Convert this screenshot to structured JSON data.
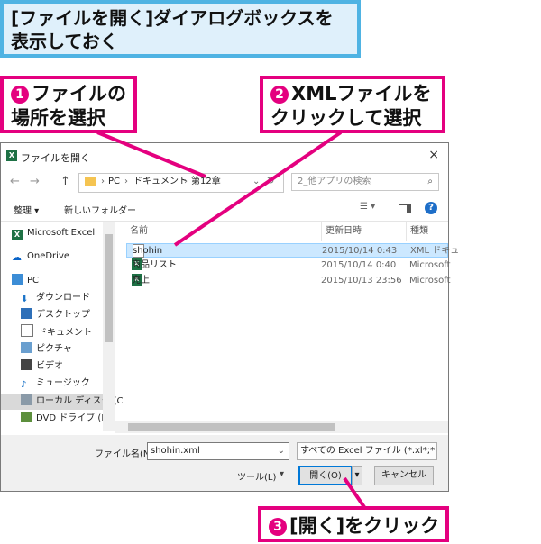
{
  "banner": {
    "line1": "[ファイルを開く]ダイアログボックスを",
    "line2": "表示しておく"
  },
  "callouts": [
    {
      "num": "1",
      "line1": "ファイルの",
      "line2": "場所を選択"
    },
    {
      "num": "2",
      "line1": "XMLファイルを",
      "line2": "クリックして選択"
    },
    {
      "num": "3",
      "line1": "[開く]をクリック"
    }
  ],
  "dialog": {
    "title": "ファイルを開く",
    "close": "×",
    "nav": {
      "back": "←",
      "forward": "→",
      "up": "↑",
      "path": [
        "PC",
        "ドキュメント",
        "第12章"
      ],
      "search_placeholder": "2_他アプリの検索"
    },
    "toolbar": {
      "organize": "整理 ▾",
      "new_folder": "新しいフォルダー"
    },
    "sidebar": [
      {
        "label": "Microsoft Excel",
        "icon": "excel-icon"
      },
      {
        "label": "OneDrive",
        "icon": "cloud-icon"
      },
      {
        "label": "PC",
        "icon": "computer-icon"
      },
      {
        "label": "ダウンロード",
        "icon": "download-icon"
      },
      {
        "label": "デスクトップ",
        "icon": "desktop-icon"
      },
      {
        "label": "ドキュメント",
        "icon": "document-icon"
      },
      {
        "label": "ピクチャ",
        "icon": "picture-icon"
      },
      {
        "label": "ビデオ",
        "icon": "video-icon"
      },
      {
        "label": "ミュージック",
        "icon": "music-icon"
      },
      {
        "label": "ローカル ディスク (C",
        "icon": "disk-icon"
      },
      {
        "label": "DVD ドライブ (D:)",
        "icon": "dvd-icon"
      }
    ],
    "columns": [
      "名前",
      "更新日時",
      "種類"
    ],
    "files": [
      {
        "name": "shohin",
        "date": "2015/10/14 0:43",
        "type": "XML ドキュ",
        "selected": true,
        "icon": "xml-file-icon"
      },
      {
        "name": "商品リスト",
        "date": "2015/10/14 0:40",
        "type": "Microsoft",
        "selected": false,
        "icon": "excel-file-icon"
      },
      {
        "name": "売上",
        "date": "2015/10/13 23:56",
        "type": "Microsoft",
        "selected": false,
        "icon": "excel-file-icon"
      }
    ],
    "filename_label": "ファイル名(N):",
    "filename_value": "shohin.xml",
    "filter": "すべての Excel ファイル (*.xl*;*.xlsx",
    "tools": "ツール(L)",
    "open": "開く(O)",
    "cancel": "キャンセル"
  },
  "colors": {
    "accent": "#e4007f",
    "banner_border": "#4fb3e3",
    "banner_bg": "#dff0fb",
    "selection": "#cce8ff"
  }
}
